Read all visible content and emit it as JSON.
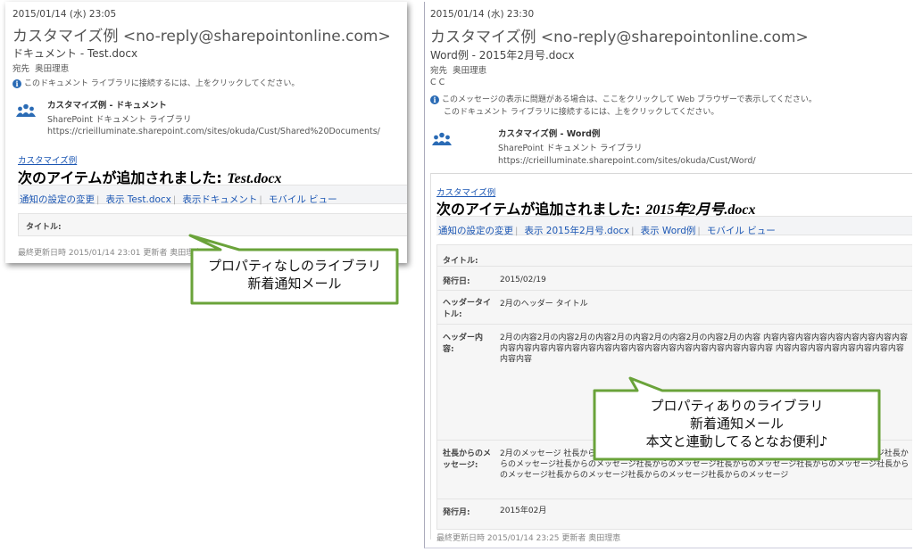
{
  "left": {
    "date": "2015/01/14 (水) 23:05",
    "subject": "カスタマイズ例 <no-reply@sharepointonline.com>",
    "doc_title": "ドキュメント - Test.docx",
    "to_label": "宛先",
    "to_name": "奥田理恵",
    "notice": "このドキュメント ライブラリに接続するには、上をクリックしてください。",
    "lib_title": "カスタマイズ例 - ドキュメント",
    "lib_type": "SharePoint ドキュメント ライブラリ",
    "lib_url": "https://crieilluminate.sharepoint.com/sites/okuda/Cust/Shared%20Documents/",
    "crumb": "カスタマイズ例",
    "headline_prefix": "次のアイテムが追加されました: ",
    "headline_item": "Test.docx",
    "menu": [
      "通知の設定の変更",
      "表示 Test.docx",
      "表示ドキュメント",
      "モバイル ビュー"
    ],
    "prop_title_label": "タイトル:",
    "footer": "最終更新日時 2015/01/14 23:01 更新者 奥田理恵"
  },
  "right": {
    "date": "2015/01/14 (水) 23:30",
    "subject": "カスタマイズ例 <no-reply@sharepointonline.com>",
    "doc_title": "Word例 - 2015年2月号.docx",
    "to_label": "宛先",
    "to_name": "奥田理恵",
    "cc_label": "C C",
    "notice1": "このメッセージの表示に問題がある場合は、ここをクリックして Web ブラウザーで表示してください。",
    "notice2": "このドキュメント ライブラリに接続するには、上をクリックしてください。",
    "lib_title": "カスタマイズ例 - Word例",
    "lib_type": "SharePoint ドキュメント ライブラリ",
    "lib_url": "https://crieilluminate.sharepoint.com/sites/okuda/Cust/Word/",
    "crumb": "カスタマイズ例",
    "headline_prefix": "次のアイテムが追加されました: ",
    "headline_item": "2015年2月号.docx",
    "menu": [
      "通知の設定の変更",
      "表示 2015年2月号.docx",
      "表示 Word例",
      "モバイル ビュー"
    ],
    "props": [
      {
        "label": "タイトル:",
        "value": ""
      },
      {
        "label": "発行日:",
        "value": "2015/02/19"
      },
      {
        "label": "ヘッダータイトル:",
        "value": "2月のヘッダー タイトル"
      },
      {
        "label": "ヘッダー内容:",
        "value": "2月の内容2月の内容2月の内容2月の内容2月の内容2月の内容2月の内容 内容内容内容内容内容内容内容内容内容内容内容内容内容内容内容内容内容内容内容内容内容内容内容内容内容内容 内容内容内容内容内容内容内容内容内容内容"
      },
      {
        "label": "社長からのメッセージ:",
        "value": "2月のメッセージ 社長からのメッセージ社長からのメッセージ社長からのメッセージ社長からのメッセージ社長からのメッセージ社長からのメッセージ社長からのメッセージ社長からのメッセージ社長からのメッセージ社長からのメッセージ社長からのメッセージ社長からのメッセージ社長からのメッセージ"
      },
      {
        "label": "発行月:",
        "value": "2015年02月"
      }
    ],
    "footer": "最終更新日時 2015/01/14 23:25 更新者 奥田理恵"
  },
  "callouts": {
    "left_line1": "プロパティなしのライブラリ",
    "left_line2": "新着通知メール",
    "right_line1": "プロパティありのライブラリ",
    "right_line2": "新着通知メール",
    "right_line3": "本文と連動してるとなお便利♪"
  },
  "colors": {
    "callout_border": "#6aa33a",
    "link": "#1b56b3",
    "people_icon": "#2a6bb5"
  },
  "icons": [
    "info-icon",
    "people-icon"
  ]
}
